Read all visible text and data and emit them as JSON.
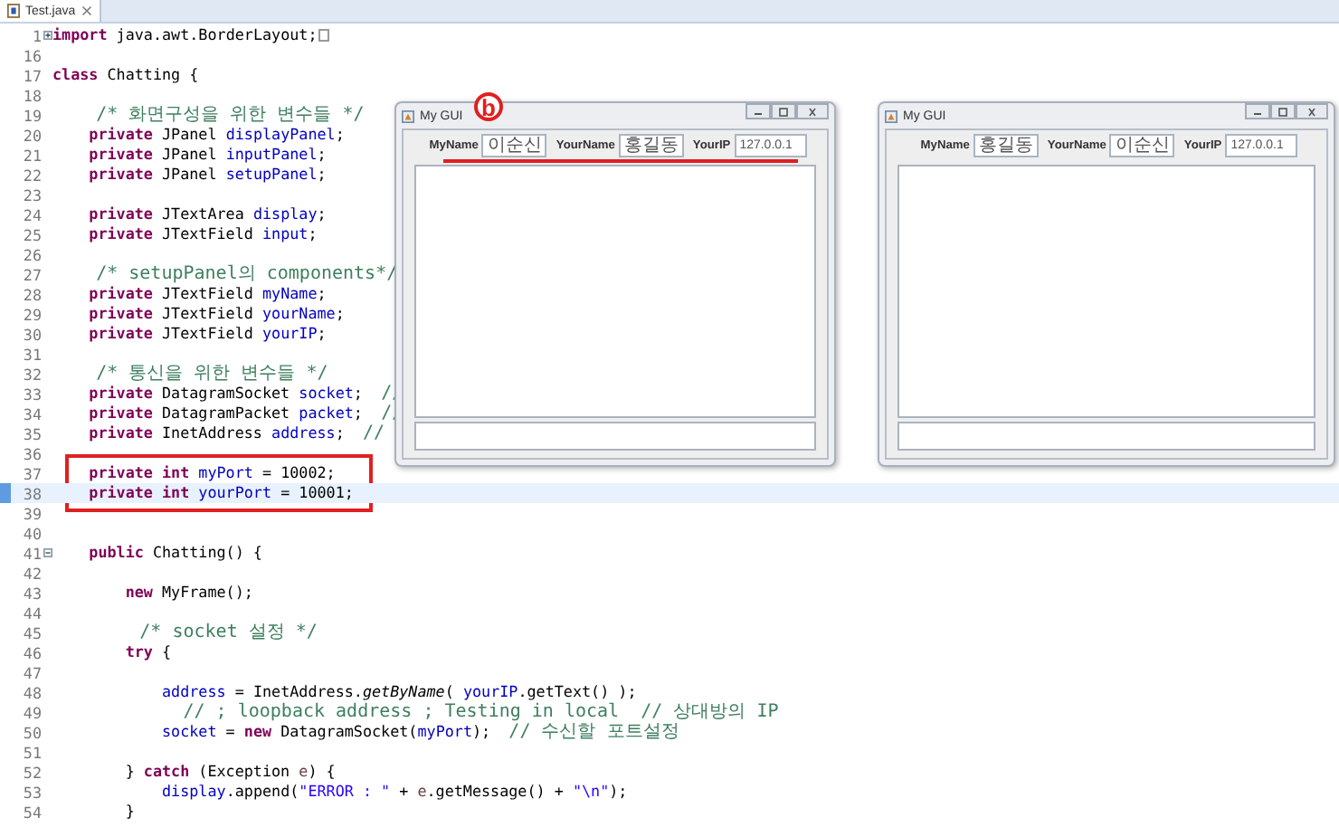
{
  "editor_tab": {
    "title": "Test.java",
    "selected": true
  },
  "editor": {
    "lines": [
      {
        "number": "1",
        "fold_marker": {
          "collapsed": true
        },
        "highlighted": false,
        "boxed": false,
        "collapsed_marker": true,
        "segments": [
          {
            "kind": "keyword",
            "text": "import"
          },
          {
            "kind": "plain",
            "text": " java.awt.BorderLayout;"
          }
        ]
      },
      {
        "number": "16",
        "highlighted": false,
        "boxed": false
      },
      {
        "number": "17",
        "highlighted": false,
        "boxed": false,
        "segments": [
          {
            "kind": "keyword",
            "text": "class"
          },
          {
            "kind": "plain",
            "text": " Chatting {"
          }
        ]
      },
      {
        "number": "18",
        "highlighted": false,
        "boxed": false
      },
      {
        "number": "19",
        "highlighted": false,
        "boxed": false,
        "segments": [
          {
            "kind": "comment",
            "text": "    /* 화면구성을 위한 변수들 */"
          }
        ]
      },
      {
        "number": "20",
        "highlighted": false,
        "boxed": false,
        "segments": [
          {
            "kind": "keyword",
            "text": "    private"
          },
          {
            "kind": "plain",
            "text": " JPanel "
          },
          {
            "kind": "field",
            "text": "displayPanel"
          },
          {
            "kind": "plain",
            "text": ";"
          }
        ]
      },
      {
        "number": "21",
        "highlighted": false,
        "boxed": false,
        "segments": [
          {
            "kind": "keyword",
            "text": "    private"
          },
          {
            "kind": "plain",
            "text": " JPanel "
          },
          {
            "kind": "field",
            "text": "inputPanel"
          },
          {
            "kind": "plain",
            "text": ";"
          }
        ]
      },
      {
        "number": "22",
        "highlighted": false,
        "boxed": false,
        "segments": [
          {
            "kind": "keyword",
            "text": "    private"
          },
          {
            "kind": "plain",
            "text": " JPanel "
          },
          {
            "kind": "field",
            "text": "setupPanel"
          },
          {
            "kind": "plain",
            "text": ";"
          }
        ]
      },
      {
        "number": "23",
        "highlighted": false,
        "boxed": false
      },
      {
        "number": "24",
        "highlighted": false,
        "boxed": false,
        "segments": [
          {
            "kind": "keyword",
            "text": "    private"
          },
          {
            "kind": "plain",
            "text": " JTextArea "
          },
          {
            "kind": "field",
            "text": "display"
          },
          {
            "kind": "plain",
            "text": ";"
          }
        ]
      },
      {
        "number": "25",
        "highlighted": false,
        "boxed": false,
        "segments": [
          {
            "kind": "keyword",
            "text": "    private"
          },
          {
            "kind": "plain",
            "text": " JTextField "
          },
          {
            "kind": "field",
            "text": "input"
          },
          {
            "kind": "plain",
            "text": ";"
          }
        ]
      },
      {
        "number": "26",
        "highlighted": false,
        "boxed": false
      },
      {
        "number": "27",
        "highlighted": false,
        "boxed": false,
        "segments": [
          {
            "kind": "comment",
            "text": "    /* setupPanel의 components*/"
          }
        ]
      },
      {
        "number": "28",
        "highlighted": false,
        "boxed": false,
        "segments": [
          {
            "kind": "keyword",
            "text": "    private"
          },
          {
            "kind": "plain",
            "text": " JTextField "
          },
          {
            "kind": "field",
            "text": "myName"
          },
          {
            "kind": "plain",
            "text": ";"
          }
        ]
      },
      {
        "number": "29",
        "highlighted": false,
        "boxed": false,
        "segments": [
          {
            "kind": "keyword",
            "text": "    private"
          },
          {
            "kind": "plain",
            "text": " JTextField "
          },
          {
            "kind": "field",
            "text": "yourName"
          },
          {
            "kind": "plain",
            "text": ";"
          }
        ]
      },
      {
        "number": "30",
        "highlighted": false,
        "boxed": false,
        "segments": [
          {
            "kind": "keyword",
            "text": "    private"
          },
          {
            "kind": "plain",
            "text": " JTextField "
          },
          {
            "kind": "field",
            "text": "yourIP"
          },
          {
            "kind": "plain",
            "text": ";"
          }
        ]
      },
      {
        "number": "31",
        "highlighted": false,
        "boxed": false
      },
      {
        "number": "32",
        "highlighted": false,
        "boxed": false,
        "segments": [
          {
            "kind": "comment",
            "text": "    /* 통신을 위한 변수들 */"
          }
        ]
      },
      {
        "number": "33",
        "highlighted": false,
        "boxed": false,
        "segments": [
          {
            "kind": "keyword",
            "text": "    private"
          },
          {
            "kind": "plain",
            "text": " DatagramSocket "
          },
          {
            "kind": "field",
            "text": "socket"
          },
          {
            "kind": "plain",
            "text": ";  "
          },
          {
            "kind": "comment",
            "text": "//"
          }
        ]
      },
      {
        "number": "34",
        "highlighted": false,
        "boxed": false,
        "segments": [
          {
            "kind": "keyword",
            "text": "    private"
          },
          {
            "kind": "plain",
            "text": " DatagramPacket "
          },
          {
            "kind": "field",
            "text": "packet"
          },
          {
            "kind": "plain",
            "text": ";  "
          },
          {
            "kind": "comment",
            "text": "//"
          }
        ]
      },
      {
        "number": "35",
        "highlighted": false,
        "boxed": false,
        "segments": [
          {
            "kind": "keyword",
            "text": "    private"
          },
          {
            "kind": "plain",
            "text": " InetAddress "
          },
          {
            "kind": "field",
            "text": "address"
          },
          {
            "kind": "plain",
            "text": ";  "
          },
          {
            "kind": "comment",
            "text": "//"
          }
        ]
      },
      {
        "number": "36",
        "highlighted": false,
        "boxed": false
      },
      {
        "number": "37",
        "highlighted": false,
        "boxed": true,
        "segments": [
          {
            "kind": "keyword",
            "text": "    private int"
          },
          {
            "kind": "field",
            "text": " myPort"
          },
          {
            "kind": "plain",
            "text": " = 10002;"
          }
        ]
      },
      {
        "number": "38",
        "highlighted": true,
        "boxed": true,
        "segments": [
          {
            "kind": "keyword",
            "text": "    private int"
          },
          {
            "kind": "field",
            "text": " yourPort"
          },
          {
            "kind": "plain",
            "text": " = 10001;"
          }
        ]
      },
      {
        "number": "39",
        "highlighted": false,
        "boxed": false
      },
      {
        "number": "40",
        "highlighted": false,
        "boxed": false
      },
      {
        "number": "41",
        "fold_marker": {
          "collapsed": false
        },
        "highlighted": false,
        "boxed": false,
        "segments": [
          {
            "kind": "keyword",
            "text": "    public"
          },
          {
            "kind": "plain",
            "text": " Chatting() {"
          }
        ]
      },
      {
        "number": "42",
        "highlighted": false,
        "boxed": false
      },
      {
        "number": "43",
        "highlighted": false,
        "boxed": false,
        "segments": [
          {
            "kind": "keyword",
            "text": "        new"
          },
          {
            "kind": "plain",
            "text": " MyFrame();"
          }
        ]
      },
      {
        "number": "44",
        "highlighted": false,
        "boxed": false
      },
      {
        "number": "45",
        "highlighted": false,
        "boxed": false,
        "segments": [
          {
            "kind": "comment",
            "text": "        /* socket 설정 */"
          }
        ]
      },
      {
        "number": "46",
        "highlighted": false,
        "boxed": false,
        "segments": [
          {
            "kind": "keyword",
            "text": "        try"
          },
          {
            "kind": "plain",
            "text": " {"
          }
        ]
      },
      {
        "number": "47",
        "highlighted": false,
        "boxed": false
      },
      {
        "number": "48",
        "highlighted": false,
        "boxed": false,
        "segments": [
          {
            "kind": "field",
            "text": "            address"
          },
          {
            "kind": "plain",
            "text": " = InetAddress."
          },
          {
            "kind": "static_method",
            "text": "getByName"
          },
          {
            "kind": "plain",
            "text": "( "
          },
          {
            "kind": "field",
            "text": "yourIP"
          },
          {
            "kind": "plain",
            "text": ".getText() );"
          }
        ]
      },
      {
        "number": "49",
        "highlighted": false,
        "boxed": false,
        "segments": [
          {
            "kind": "comment",
            "text": "            // ; loopback address ; Testing in local  // 상대방의 IP"
          }
        ]
      },
      {
        "number": "50",
        "highlighted": false,
        "boxed": false,
        "segments": [
          {
            "kind": "field",
            "text": "            socket"
          },
          {
            "kind": "plain",
            "text": " = "
          },
          {
            "kind": "keyword",
            "text": "new"
          },
          {
            "kind": "plain",
            "text": " DatagramSocket("
          },
          {
            "kind": "field",
            "text": "myPort"
          },
          {
            "kind": "plain",
            "text": ");  "
          },
          {
            "kind": "comment",
            "text": "// 수신할 포트설정"
          }
        ]
      },
      {
        "number": "51",
        "highlighted": false,
        "boxed": false
      },
      {
        "number": "52",
        "highlighted": false,
        "boxed": false,
        "segments": [
          {
            "kind": "plain",
            "text": "        } "
          },
          {
            "kind": "keyword",
            "text": "catch"
          },
          {
            "kind": "plain",
            "text": " (Exception "
          },
          {
            "kind": "local",
            "text": "e"
          },
          {
            "kind": "plain",
            "text": ") {"
          }
        ]
      },
      {
        "number": "53",
        "highlighted": false,
        "boxed": false,
        "segments": [
          {
            "kind": "field",
            "text": "            display"
          },
          {
            "kind": "plain",
            "text": ".append("
          },
          {
            "kind": "string",
            "text": "\"ERROR : \""
          },
          {
            "kind": "plain",
            "text": " + "
          },
          {
            "kind": "local",
            "text": "e"
          },
          {
            "kind": "plain",
            "text": ".getMessage() + "
          },
          {
            "kind": "string",
            "text": "\"\\n\""
          },
          {
            "kind": "plain",
            "text": ");"
          }
        ]
      },
      {
        "number": "54",
        "highlighted": false,
        "boxed": false,
        "segments": [
          {
            "kind": "plain",
            "text": "        }"
          }
        ]
      }
    ]
  },
  "windows": [
    {
      "title": "My GUI",
      "annotation": "b",
      "fields": [
        {
          "label": "MyName",
          "value": "이순신"
        },
        {
          "label": "YourName",
          "value": "홍길동"
        },
        {
          "label": "YourIP",
          "value": "127.0.0.1"
        }
      ]
    },
    {
      "title": "My GUI",
      "fields": [
        {
          "label": "MyName",
          "value": "홍길동"
        },
        {
          "label": "YourName",
          "value": "이순신"
        },
        {
          "label": "YourIP",
          "value": "127.0.0.1"
        }
      ]
    }
  ]
}
